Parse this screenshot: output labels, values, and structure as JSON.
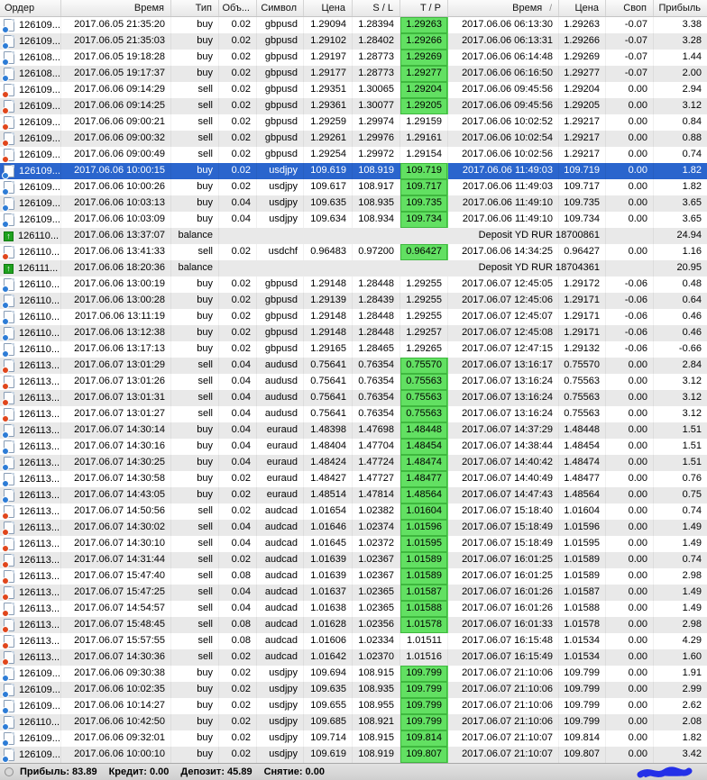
{
  "table": {
    "columns": [
      {
        "label": "Ордер",
        "align": "left"
      },
      {
        "label": "Время",
        "align": "right"
      },
      {
        "label": "Тип",
        "align": "right"
      },
      {
        "label": "Объ...",
        "align": "right"
      },
      {
        "label": "Символ",
        "align": "right"
      },
      {
        "label": "Цена",
        "align": "right"
      },
      {
        "label": "S / L",
        "align": "right"
      },
      {
        "label": "T / P",
        "align": "right"
      },
      {
        "label": "Время",
        "align": "right",
        "sort_glyph": "/"
      },
      {
        "label": "Цена",
        "align": "right"
      },
      {
        "label": "Своп",
        "align": "right"
      },
      {
        "label": "Прибыль",
        "align": "right"
      }
    ],
    "rows": [
      {
        "order": "126109...",
        "open_time": "2017.06.05 21:35:20",
        "type": "buy",
        "volume": "0.02",
        "symbol": "gbpusd",
        "open_price": "1.29094",
        "sl": "1.28394",
        "tp": "1.29263",
        "tp_hit": true,
        "close_time": "2017.06.06 06:13:30",
        "close_price": "1.29263",
        "swap": "-0.07",
        "profit": "3.38"
      },
      {
        "order": "126109...",
        "open_time": "2017.06.05 21:35:03",
        "type": "buy",
        "volume": "0.02",
        "symbol": "gbpusd",
        "open_price": "1.29102",
        "sl": "1.28402",
        "tp": "1.29266",
        "tp_hit": true,
        "close_time": "2017.06.06 06:13:31",
        "close_price": "1.29266",
        "swap": "-0.07",
        "profit": "3.28"
      },
      {
        "order": "126108...",
        "open_time": "2017.06.05 19:18:28",
        "type": "buy",
        "volume": "0.02",
        "symbol": "gbpusd",
        "open_price": "1.29197",
        "sl": "1.28773",
        "tp": "1.29269",
        "tp_hit": true,
        "close_time": "2017.06.06 06:14:48",
        "close_price": "1.29269",
        "swap": "-0.07",
        "profit": "1.44"
      },
      {
        "order": "126108...",
        "open_time": "2017.06.05 19:17:37",
        "type": "buy",
        "volume": "0.02",
        "symbol": "gbpusd",
        "open_price": "1.29177",
        "sl": "1.28773",
        "tp": "1.29277",
        "tp_hit": true,
        "close_time": "2017.06.06 06:16:50",
        "close_price": "1.29277",
        "swap": "-0.07",
        "profit": "2.00"
      },
      {
        "order": "126109...",
        "open_time": "2017.06.06 09:14:29",
        "type": "sell",
        "volume": "0.02",
        "symbol": "gbpusd",
        "open_price": "1.29351",
        "sl": "1.30065",
        "tp": "1.29204",
        "tp_hit": true,
        "close_time": "2017.06.06 09:45:56",
        "close_price": "1.29204",
        "swap": "0.00",
        "profit": "2.94"
      },
      {
        "order": "126109...",
        "open_time": "2017.06.06 09:14:25",
        "type": "sell",
        "volume": "0.02",
        "symbol": "gbpusd",
        "open_price": "1.29361",
        "sl": "1.30077",
        "tp": "1.29205",
        "tp_hit": true,
        "close_time": "2017.06.06 09:45:56",
        "close_price": "1.29205",
        "swap": "0.00",
        "profit": "3.12"
      },
      {
        "order": "126109...",
        "open_time": "2017.06.06 09:00:21",
        "type": "sell",
        "volume": "0.02",
        "symbol": "gbpusd",
        "open_price": "1.29259",
        "sl": "1.29974",
        "tp": "1.29159",
        "tp_hit": false,
        "close_time": "2017.06.06 10:02:52",
        "close_price": "1.29217",
        "swap": "0.00",
        "profit": "0.84"
      },
      {
        "order": "126109...",
        "open_time": "2017.06.06 09:00:32",
        "type": "sell",
        "volume": "0.02",
        "symbol": "gbpusd",
        "open_price": "1.29261",
        "sl": "1.29976",
        "tp": "1.29161",
        "tp_hit": false,
        "close_time": "2017.06.06 10:02:54",
        "close_price": "1.29217",
        "swap": "0.00",
        "profit": "0.88"
      },
      {
        "order": "126109...",
        "open_time": "2017.06.06 09:00:49",
        "type": "sell",
        "volume": "0.02",
        "symbol": "gbpusd",
        "open_price": "1.29254",
        "sl": "1.29972",
        "tp": "1.29154",
        "tp_hit": false,
        "close_time": "2017.06.06 10:02:56",
        "close_price": "1.29217",
        "swap": "0.00",
        "profit": "0.74"
      },
      {
        "order": "126109...",
        "open_time": "2017.06.06 10:00:15",
        "type": "buy",
        "volume": "0.02",
        "symbol": "usdjpy",
        "open_price": "109.619",
        "sl": "108.919",
        "tp": "109.719",
        "tp_hit": true,
        "close_time": "2017.06.06 11:49:03",
        "close_price": "109.719",
        "swap": "0.00",
        "profit": "1.82",
        "selected": true
      },
      {
        "order": "126109...",
        "open_time": "2017.06.06 10:00:26",
        "type": "buy",
        "volume": "0.02",
        "symbol": "usdjpy",
        "open_price": "109.617",
        "sl": "108.917",
        "tp": "109.717",
        "tp_hit": true,
        "close_time": "2017.06.06 11:49:03",
        "close_price": "109.717",
        "swap": "0.00",
        "profit": "1.82"
      },
      {
        "order": "126109...",
        "open_time": "2017.06.06 10:03:13",
        "type": "buy",
        "volume": "0.04",
        "symbol": "usdjpy",
        "open_price": "109.635",
        "sl": "108.935",
        "tp": "109.735",
        "tp_hit": true,
        "close_time": "2017.06.06 11:49:10",
        "close_price": "109.735",
        "swap": "0.00",
        "profit": "3.65"
      },
      {
        "order": "126109...",
        "open_time": "2017.06.06 10:03:09",
        "type": "buy",
        "volume": "0.04",
        "symbol": "usdjpy",
        "open_price": "109.634",
        "sl": "108.934",
        "tp": "109.734",
        "tp_hit": true,
        "close_time": "2017.06.06 11:49:10",
        "close_price": "109.734",
        "swap": "0.00",
        "profit": "3.65"
      },
      {
        "order": "126110...",
        "open_time": "2017.06.06 13:37:07",
        "type": "balance",
        "balance_text": "Deposit YD RUR 18700861",
        "profit": "24.94"
      },
      {
        "order": "126110...",
        "open_time": "2017.06.06 13:41:33",
        "type": "sell",
        "volume": "0.02",
        "symbol": "usdchf",
        "open_price": "0.96483",
        "sl": "0.97200",
        "tp": "0.96427",
        "tp_hit": true,
        "close_time": "2017.06.06 14:34:25",
        "close_price": "0.96427",
        "swap": "0.00",
        "profit": "1.16"
      },
      {
        "order": "126111...",
        "open_time": "2017.06.06 18:20:36",
        "type": "balance",
        "balance_text": "Deposit YD RUR 18704361",
        "profit": "20.95"
      },
      {
        "order": "126110...",
        "open_time": "2017.06.06 13:00:19",
        "type": "buy",
        "volume": "0.02",
        "symbol": "gbpusd",
        "open_price": "1.29148",
        "sl": "1.28448",
        "tp": "1.29255",
        "tp_hit": false,
        "close_time": "2017.06.07 12:45:05",
        "close_price": "1.29172",
        "swap": "-0.06",
        "profit": "0.48"
      },
      {
        "order": "126110...",
        "open_time": "2017.06.06 13:00:28",
        "type": "buy",
        "volume": "0.02",
        "symbol": "gbpusd",
        "open_price": "1.29139",
        "sl": "1.28439",
        "tp": "1.29255",
        "tp_hit": false,
        "close_time": "2017.06.07 12:45:06",
        "close_price": "1.29171",
        "swap": "-0.06",
        "profit": "0.64"
      },
      {
        "order": "126110...",
        "open_time": "2017.06.06 13:11:19",
        "type": "buy",
        "volume": "0.02",
        "symbol": "gbpusd",
        "open_price": "1.29148",
        "sl": "1.28448",
        "tp": "1.29255",
        "tp_hit": false,
        "close_time": "2017.06.07 12:45:07",
        "close_price": "1.29171",
        "swap": "-0.06",
        "profit": "0.46"
      },
      {
        "order": "126110...",
        "open_time": "2017.06.06 13:12:38",
        "type": "buy",
        "volume": "0.02",
        "symbol": "gbpusd",
        "open_price": "1.29148",
        "sl": "1.28448",
        "tp": "1.29257",
        "tp_hit": false,
        "close_time": "2017.06.07 12:45:08",
        "close_price": "1.29171",
        "swap": "-0.06",
        "profit": "0.46"
      },
      {
        "order": "126110...",
        "open_time": "2017.06.06 13:17:13",
        "type": "buy",
        "volume": "0.02",
        "symbol": "gbpusd",
        "open_price": "1.29165",
        "sl": "1.28465",
        "tp": "1.29265",
        "tp_hit": false,
        "close_time": "2017.06.07 12:47:15",
        "close_price": "1.29132",
        "swap": "-0.06",
        "profit": "-0.66"
      },
      {
        "order": "126113...",
        "open_time": "2017.06.07 13:01:29",
        "type": "sell",
        "volume": "0.04",
        "symbol": "audusd",
        "open_price": "0.75641",
        "sl": "0.76354",
        "tp": "0.75570",
        "tp_hit": true,
        "close_time": "2017.06.07 13:16:17",
        "close_price": "0.75570",
        "swap": "0.00",
        "profit": "2.84"
      },
      {
        "order": "126113...",
        "open_time": "2017.06.07 13:01:26",
        "type": "sell",
        "volume": "0.04",
        "symbol": "audusd",
        "open_price": "0.75641",
        "sl": "0.76354",
        "tp": "0.75563",
        "tp_hit": true,
        "close_time": "2017.06.07 13:16:24",
        "close_price": "0.75563",
        "swap": "0.00",
        "profit": "3.12"
      },
      {
        "order": "126113...",
        "open_time": "2017.06.07 13:01:31",
        "type": "sell",
        "volume": "0.04",
        "symbol": "audusd",
        "open_price": "0.75641",
        "sl": "0.76354",
        "tp": "0.75563",
        "tp_hit": true,
        "close_time": "2017.06.07 13:16:24",
        "close_price": "0.75563",
        "swap": "0.00",
        "profit": "3.12"
      },
      {
        "order": "126113...",
        "open_time": "2017.06.07 13:01:27",
        "type": "sell",
        "volume": "0.04",
        "symbol": "audusd",
        "open_price": "0.75641",
        "sl": "0.76354",
        "tp": "0.75563",
        "tp_hit": true,
        "close_time": "2017.06.07 13:16:24",
        "close_price": "0.75563",
        "swap": "0.00",
        "profit": "3.12"
      },
      {
        "order": "126113...",
        "open_time": "2017.06.07 14:30:14",
        "type": "buy",
        "volume": "0.04",
        "symbol": "euraud",
        "open_price": "1.48398",
        "sl": "1.47698",
        "tp": "1.48448",
        "tp_hit": true,
        "close_time": "2017.06.07 14:37:29",
        "close_price": "1.48448",
        "swap": "0.00",
        "profit": "1.51"
      },
      {
        "order": "126113...",
        "open_time": "2017.06.07 14:30:16",
        "type": "buy",
        "volume": "0.04",
        "symbol": "euraud",
        "open_price": "1.48404",
        "sl": "1.47704",
        "tp": "1.48454",
        "tp_hit": true,
        "close_time": "2017.06.07 14:38:44",
        "close_price": "1.48454",
        "swap": "0.00",
        "profit": "1.51"
      },
      {
        "order": "126113...",
        "open_time": "2017.06.07 14:30:25",
        "type": "buy",
        "volume": "0.04",
        "symbol": "euraud",
        "open_price": "1.48424",
        "sl": "1.47724",
        "tp": "1.48474",
        "tp_hit": true,
        "close_time": "2017.06.07 14:40:42",
        "close_price": "1.48474",
        "swap": "0.00",
        "profit": "1.51"
      },
      {
        "order": "126113...",
        "open_time": "2017.06.07 14:30:58",
        "type": "buy",
        "volume": "0.02",
        "symbol": "euraud",
        "open_price": "1.48427",
        "sl": "1.47727",
        "tp": "1.48477",
        "tp_hit": true,
        "close_time": "2017.06.07 14:40:49",
        "close_price": "1.48477",
        "swap": "0.00",
        "profit": "0.76"
      },
      {
        "order": "126113...",
        "open_time": "2017.06.07 14:43:05",
        "type": "buy",
        "volume": "0.02",
        "symbol": "euraud",
        "open_price": "1.48514",
        "sl": "1.47814",
        "tp": "1.48564",
        "tp_hit": true,
        "close_time": "2017.06.07 14:47:43",
        "close_price": "1.48564",
        "swap": "0.00",
        "profit": "0.75"
      },
      {
        "order": "126113...",
        "open_time": "2017.06.07 14:50:56",
        "type": "sell",
        "volume": "0.02",
        "symbol": "audcad",
        "open_price": "1.01654",
        "sl": "1.02382",
        "tp": "1.01604",
        "tp_hit": true,
        "close_time": "2017.06.07 15:18:40",
        "close_price": "1.01604",
        "swap": "0.00",
        "profit": "0.74"
      },
      {
        "order": "126113...",
        "open_time": "2017.06.07 14:30:02",
        "type": "sell",
        "volume": "0.04",
        "symbol": "audcad",
        "open_price": "1.01646",
        "sl": "1.02374",
        "tp": "1.01596",
        "tp_hit": true,
        "close_time": "2017.06.07 15:18:49",
        "close_price": "1.01596",
        "swap": "0.00",
        "profit": "1.49"
      },
      {
        "order": "126113...",
        "open_time": "2017.06.07 14:30:10",
        "type": "sell",
        "volume": "0.04",
        "symbol": "audcad",
        "open_price": "1.01645",
        "sl": "1.02372",
        "tp": "1.01595",
        "tp_hit": true,
        "close_time": "2017.06.07 15:18:49",
        "close_price": "1.01595",
        "swap": "0.00",
        "profit": "1.49"
      },
      {
        "order": "126113...",
        "open_time": "2017.06.07 14:31:44",
        "type": "sell",
        "volume": "0.02",
        "symbol": "audcad",
        "open_price": "1.01639",
        "sl": "1.02367",
        "tp": "1.01589",
        "tp_hit": true,
        "close_time": "2017.06.07 16:01:25",
        "close_price": "1.01589",
        "swap": "0.00",
        "profit": "0.74"
      },
      {
        "order": "126113...",
        "open_time": "2017.06.07 15:47:40",
        "type": "sell",
        "volume": "0.08",
        "symbol": "audcad",
        "open_price": "1.01639",
        "sl": "1.02367",
        "tp": "1.01589",
        "tp_hit": true,
        "close_time": "2017.06.07 16:01:25",
        "close_price": "1.01589",
        "swap": "0.00",
        "profit": "2.98"
      },
      {
        "order": "126113...",
        "open_time": "2017.06.07 15:47:25",
        "type": "sell",
        "volume": "0.04",
        "symbol": "audcad",
        "open_price": "1.01637",
        "sl": "1.02365",
        "tp": "1.01587",
        "tp_hit": true,
        "close_time": "2017.06.07 16:01:26",
        "close_price": "1.01587",
        "swap": "0.00",
        "profit": "1.49"
      },
      {
        "order": "126113...",
        "open_time": "2017.06.07 14:54:57",
        "type": "sell",
        "volume": "0.04",
        "symbol": "audcad",
        "open_price": "1.01638",
        "sl": "1.02365",
        "tp": "1.01588",
        "tp_hit": true,
        "close_time": "2017.06.07 16:01:26",
        "close_price": "1.01588",
        "swap": "0.00",
        "profit": "1.49"
      },
      {
        "order": "126113...",
        "open_time": "2017.06.07 15:48:45",
        "type": "sell",
        "volume": "0.08",
        "symbol": "audcad",
        "open_price": "1.01628",
        "sl": "1.02356",
        "tp": "1.01578",
        "tp_hit": true,
        "close_time": "2017.06.07 16:01:33",
        "close_price": "1.01578",
        "swap": "0.00",
        "profit": "2.98"
      },
      {
        "order": "126113...",
        "open_time": "2017.06.07 15:57:55",
        "type": "sell",
        "volume": "0.08",
        "symbol": "audcad",
        "open_price": "1.01606",
        "sl": "1.02334",
        "tp": "1.01511",
        "tp_hit": false,
        "close_time": "2017.06.07 16:15:48",
        "close_price": "1.01534",
        "swap": "0.00",
        "profit": "4.29"
      },
      {
        "order": "126113...",
        "open_time": "2017.06.07 14:30:36",
        "type": "sell",
        "volume": "0.02",
        "symbol": "audcad",
        "open_price": "1.01642",
        "sl": "1.02370",
        "tp": "1.01516",
        "tp_hit": false,
        "close_time": "2017.06.07 16:15:49",
        "close_price": "1.01534",
        "swap": "0.00",
        "profit": "1.60"
      },
      {
        "order": "126109...",
        "open_time": "2017.06.06 09:30:38",
        "type": "buy",
        "volume": "0.02",
        "symbol": "usdjpy",
        "open_price": "109.694",
        "sl": "108.915",
        "tp": "109.799",
        "tp_hit": true,
        "close_time": "2017.06.07 21:10:06",
        "close_price": "109.799",
        "swap": "0.00",
        "profit": "1.91"
      },
      {
        "order": "126109...",
        "open_time": "2017.06.06 10:02:35",
        "type": "buy",
        "volume": "0.02",
        "symbol": "usdjpy",
        "open_price": "109.635",
        "sl": "108.935",
        "tp": "109.799",
        "tp_hit": true,
        "close_time": "2017.06.07 21:10:06",
        "close_price": "109.799",
        "swap": "0.00",
        "profit": "2.99"
      },
      {
        "order": "126109...",
        "open_time": "2017.06.06 10:14:27",
        "type": "buy",
        "volume": "0.02",
        "symbol": "usdjpy",
        "open_price": "109.655",
        "sl": "108.955",
        "tp": "109.799",
        "tp_hit": true,
        "close_time": "2017.06.07 21:10:06",
        "close_price": "109.799",
        "swap": "0.00",
        "profit": "2.62"
      },
      {
        "order": "126110...",
        "open_time": "2017.06.06 10:42:50",
        "type": "buy",
        "volume": "0.02",
        "symbol": "usdjpy",
        "open_price": "109.685",
        "sl": "108.921",
        "tp": "109.799",
        "tp_hit": true,
        "close_time": "2017.06.07 21:10:06",
        "close_price": "109.799",
        "swap": "0.00",
        "profit": "2.08"
      },
      {
        "order": "126109...",
        "open_time": "2017.06.06 09:32:01",
        "type": "buy",
        "volume": "0.02",
        "symbol": "usdjpy",
        "open_price": "109.714",
        "sl": "108.915",
        "tp": "109.814",
        "tp_hit": true,
        "close_time": "2017.06.07 21:10:07",
        "close_price": "109.814",
        "swap": "0.00",
        "profit": "1.82"
      },
      {
        "order": "126109...",
        "open_time": "2017.06.06 10:00:10",
        "type": "buy",
        "volume": "0.02",
        "symbol": "usdjpy",
        "open_price": "109.619",
        "sl": "108.919",
        "tp": "109.807",
        "tp_hit": true,
        "close_time": "2017.06.07 21:10:07",
        "close_price": "109.807",
        "swap": "0.00",
        "profit": "3.42"
      }
    ]
  },
  "statusbar": {
    "items": [
      {
        "label": "Прибыль:",
        "value": "83.89"
      },
      {
        "label": "Кредит:",
        "value": "0.00"
      },
      {
        "label": "Депозит:",
        "value": "45.89"
      },
      {
        "label": "Снятие:",
        "value": "0.00"
      }
    ]
  },
  "icons": {
    "buy": "order-buy-icon",
    "sell": "order-sell-icon",
    "balance": "deposit-icon",
    "status": "status-circle-icon",
    "scribble": "ink-scribble-annotation"
  },
  "colors": {
    "selected_row": "#2a65cd",
    "tp_highlight": "#62e062",
    "buy_dot": "#2d7cd6",
    "sell_dot": "#e0461c",
    "balance_icon_green": "#1fa11f",
    "scribble_blue": "#2430e8"
  }
}
